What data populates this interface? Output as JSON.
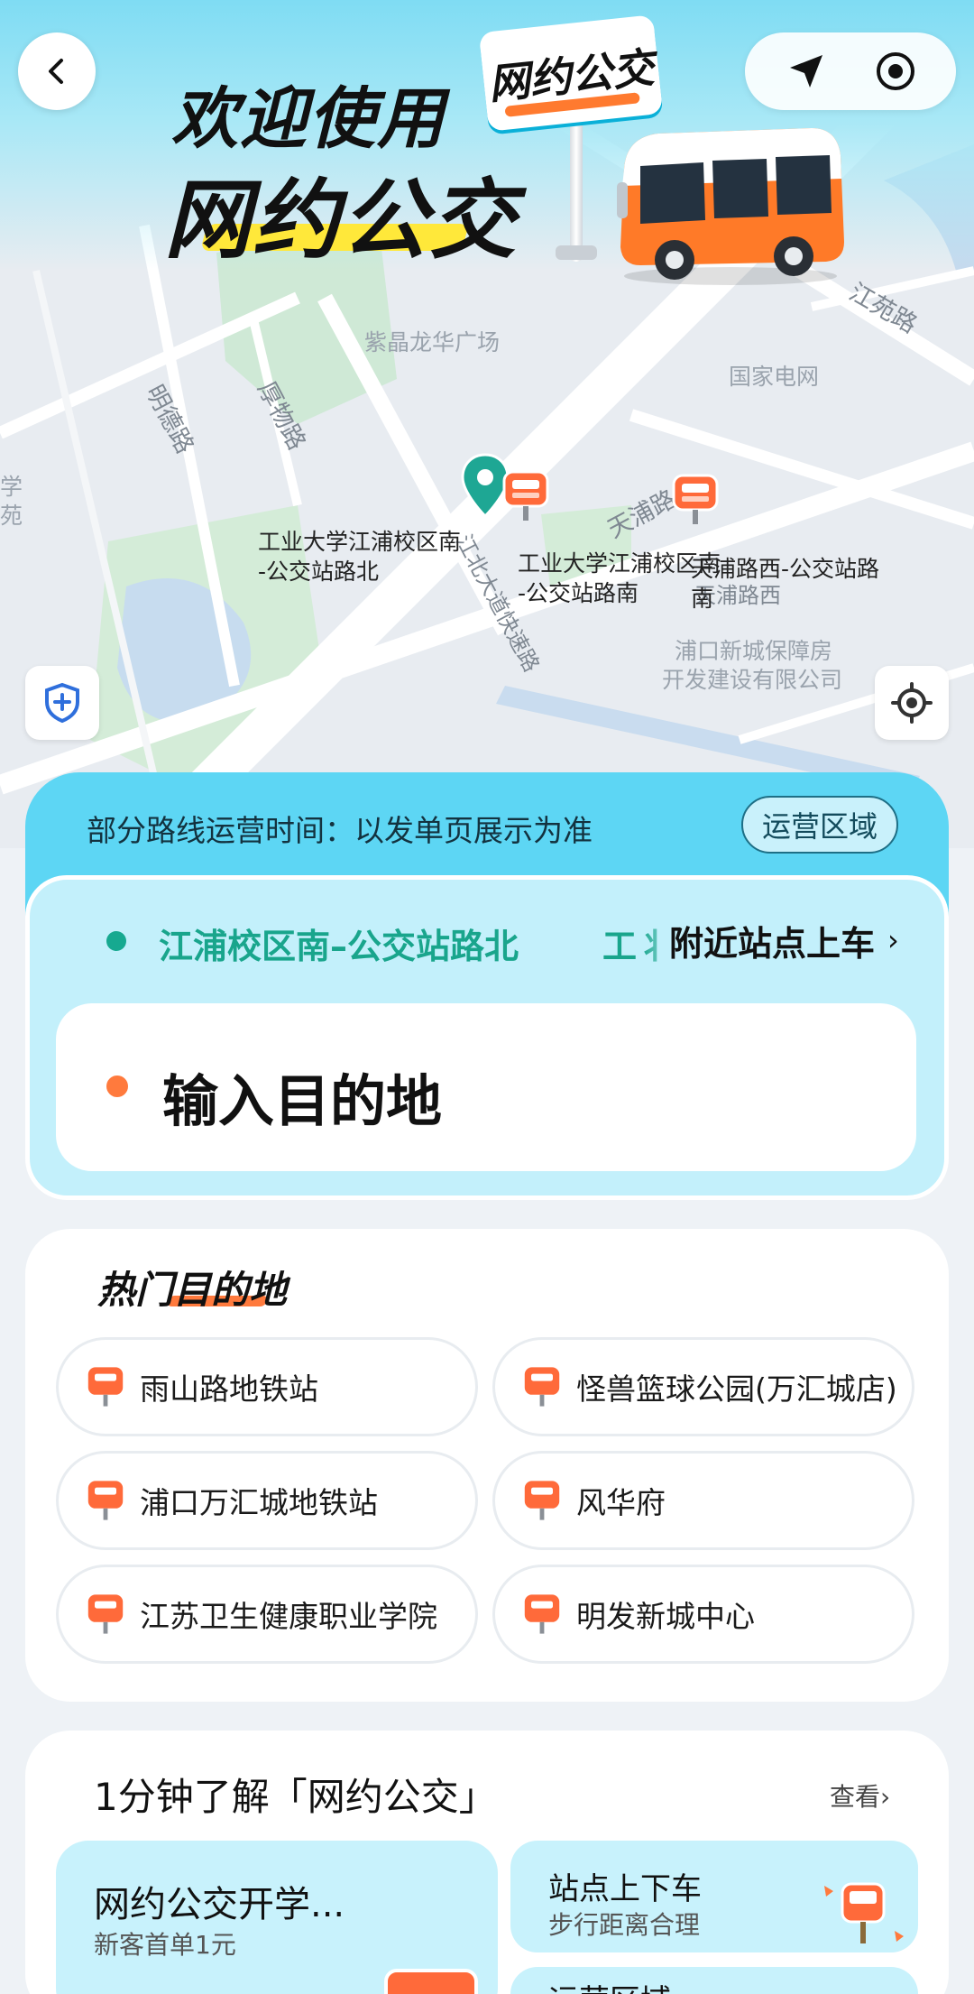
{
  "header": {
    "welcome_line1": "欢迎使用",
    "welcome_line2": "网约公交",
    "sign_text": "网约公交"
  },
  "icons": {
    "back": "chevron-left-icon",
    "navigate": "navigation-arrow-icon",
    "target": "target-icon",
    "shield": "shield-plus-icon",
    "locate": "crosshair-locate-icon",
    "stop": "bus-stop-icon"
  },
  "map": {
    "places": [
      "紫晶龙华广场",
      "国家电网",
      "浦口新城保障房",
      "开发建设有限公司",
      "学",
      "苑"
    ],
    "roads": [
      "明德路",
      "厚物路",
      "天浦路",
      "江苑路",
      "江北大道快速路",
      "天浦路西"
    ],
    "stops": [
      {
        "line1": "工业大学江浦校区南",
        "line2": "-公交站路北"
      },
      {
        "line1": "工业大学江浦校区南",
        "line2": "-公交站路南"
      },
      {
        "line1": "天浦路西-公交站路",
        "line2": "南"
      }
    ]
  },
  "operation": {
    "notice": "部分路线运营时间：以发单页展示为准",
    "area_button": "运营区域"
  },
  "trip": {
    "from": "江浦校区南–公交站路北",
    "from_overflow": "工丬",
    "nearby_link": "附近站点上车",
    "nearby_chevron": "›",
    "destination_placeholder": "输入目的地"
  },
  "hot": {
    "title": "热门目的地",
    "items": [
      "雨山路地铁站",
      "怪兽篮球公园(万汇城店)",
      "浦口万汇城地铁站",
      "风华府",
      "江苏卫生健康职业学院",
      "明发新城中心"
    ]
  },
  "learn": {
    "title": "1分钟了解「网约公交」",
    "more": "查看",
    "more_chevron": "›",
    "tiles": [
      {
        "title": "网约公交开学...",
        "subtitle": "新客首单1元"
      },
      {
        "title": "站点上下车",
        "subtitle": "步行距离合理"
      },
      {
        "title": "运营区域",
        "subtitle": ""
      }
    ]
  },
  "colors": {
    "accent_cyan": "#5dd6f4",
    "accent_green": "#19a58c",
    "accent_orange": "#ff7a3d"
  }
}
